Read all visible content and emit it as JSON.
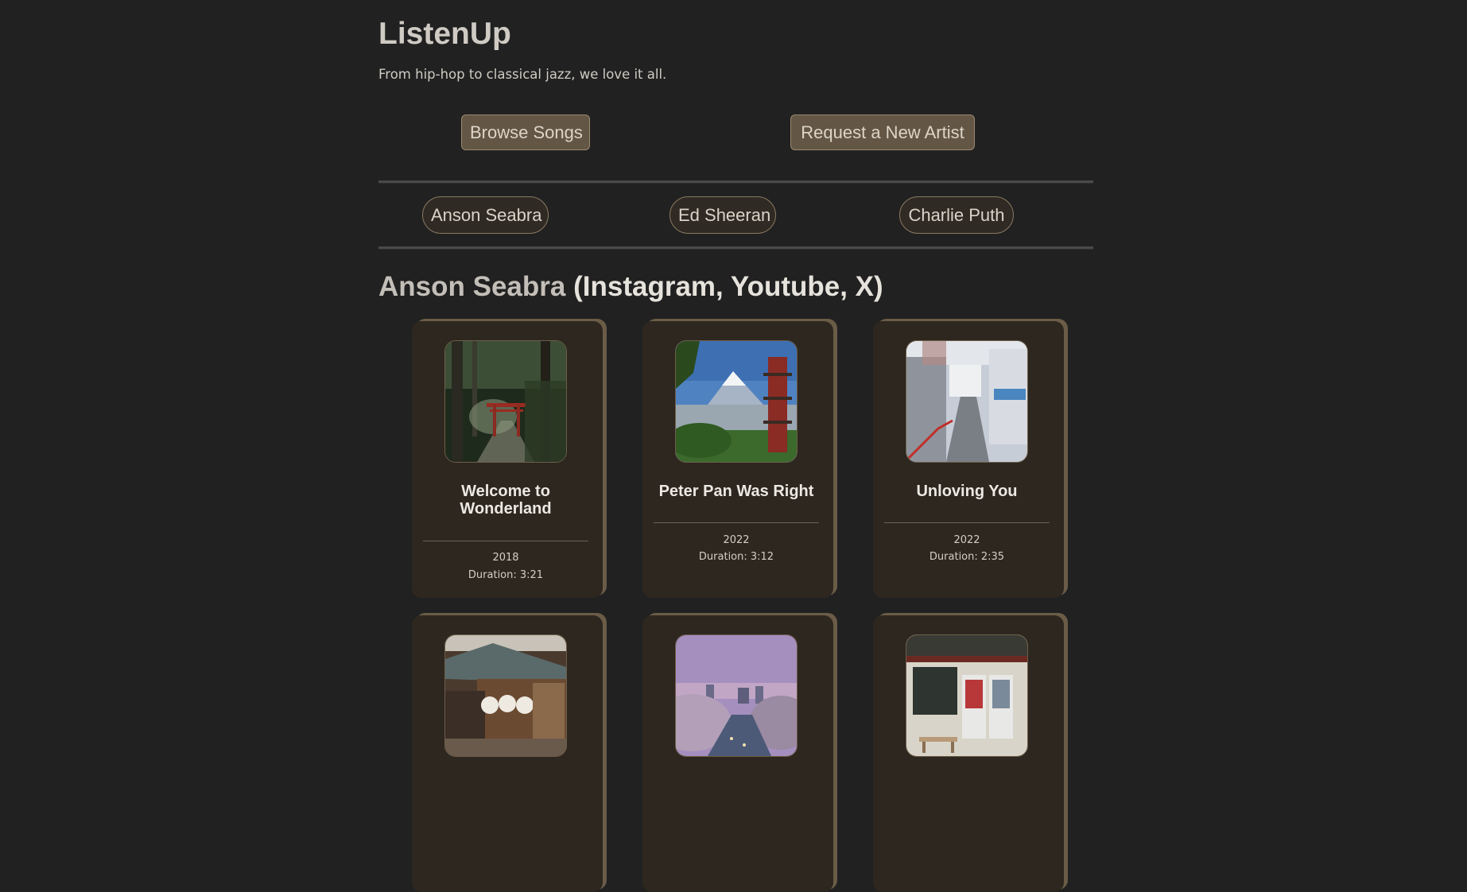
{
  "site": {
    "title": "ListenUp",
    "tagline": "From hip-hop to classical jazz, we love it all."
  },
  "actions": {
    "browse_label": "Browse Songs",
    "request_label": "Request a New Artist"
  },
  "artists": [
    "Anson Seabra",
    "Ed Sheeran",
    "Charlie Puth"
  ],
  "current_artist": {
    "name": "Anson Seabra",
    "socials_text": "(Instagram, Youtube, X)"
  },
  "songs": [
    {
      "title": "Welcome to Wonderland",
      "year": "2018",
      "duration": "Duration: 3:21",
      "cover": "forest-torii-gate-photo"
    },
    {
      "title": "Peter Pan Was Right",
      "year": "2022",
      "duration": "Duration: 3:12",
      "cover": "mount-fuji-pagoda-photo"
    },
    {
      "title": "Unloving You",
      "year": "2022",
      "duration": "Duration: 2:35",
      "cover": "tokyo-street-photo"
    },
    {
      "cover": "wooden-house-lanterns-photo"
    },
    {
      "cover": "cherry-blossom-river-photo"
    },
    {
      "cover": "vending-machine-shop-photo"
    }
  ],
  "colors": {
    "background": "#212121",
    "card": "#2d2720",
    "card_accent": "#6b5c47",
    "button": "#635644"
  }
}
